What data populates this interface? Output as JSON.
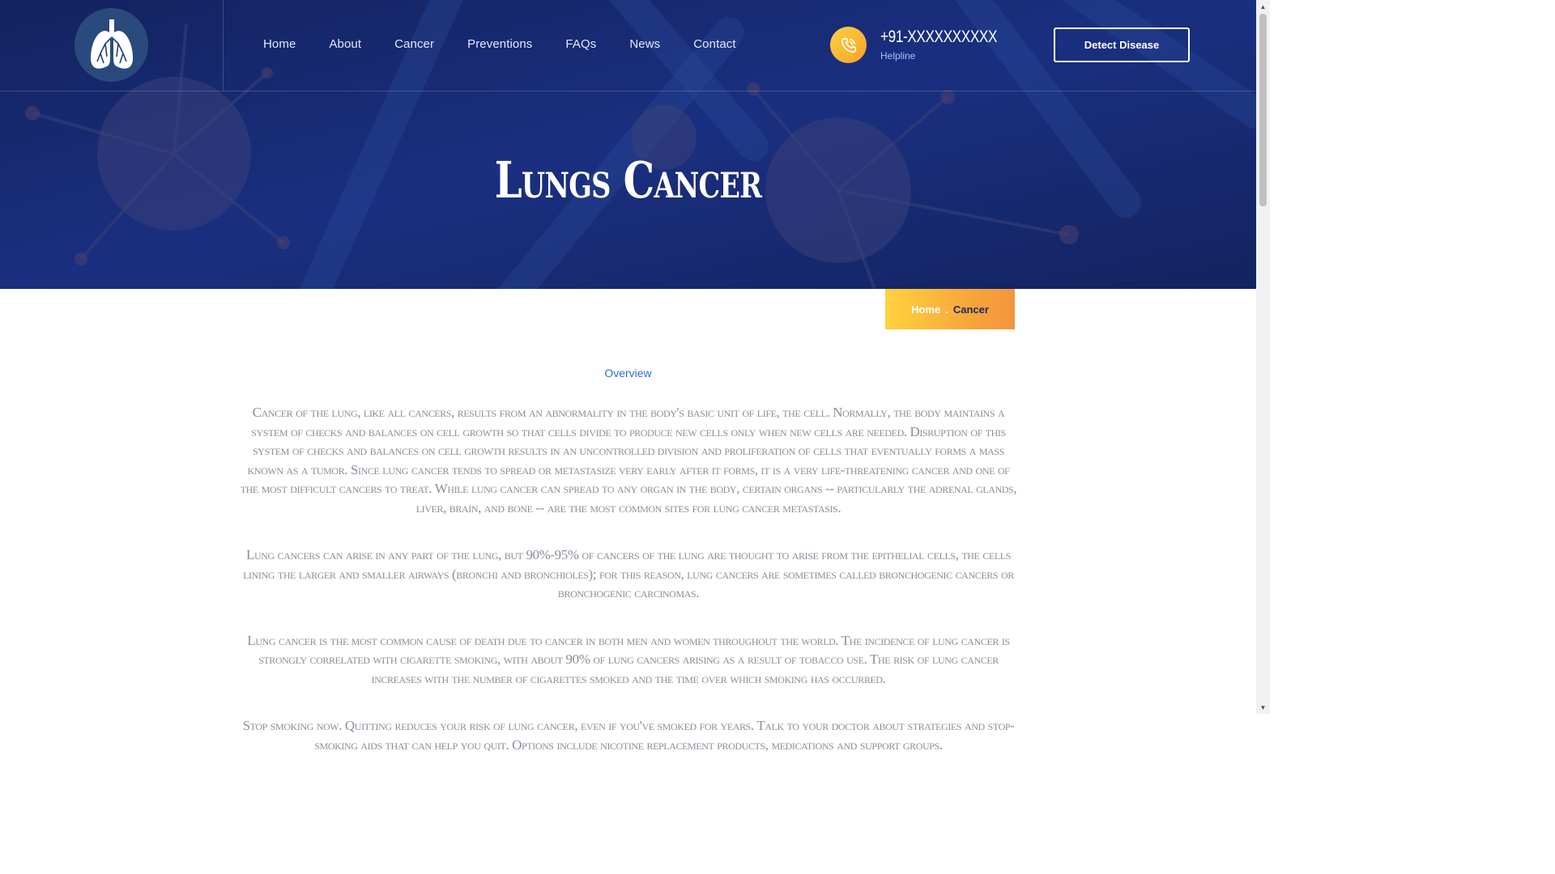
{
  "brand": {
    "logo_icon": "lungs-icon"
  },
  "nav": {
    "items": [
      {
        "label": "Home"
      },
      {
        "label": "About"
      },
      {
        "label": "Cancer"
      },
      {
        "label": "Preventions"
      },
      {
        "label": "FAQs"
      },
      {
        "label": "News"
      },
      {
        "label": "Contact"
      }
    ]
  },
  "contact": {
    "icon": "phone-icon",
    "number": "+91-XXXXXXXXXX",
    "label": "Helpline"
  },
  "cta": {
    "label": "Detect Disease"
  },
  "hero": {
    "title": "Lungs Cancer"
  },
  "breadcrumb": {
    "home": "Home",
    "separator": ".",
    "current": "Cancer"
  },
  "section": {
    "tag": "Overview"
  },
  "paragraphs": [
    "Cancer of the lung, like all cancers, results from an abnormality in the body's basic unit of life, the cell. Normally, the body maintains a system of checks and balances on cell growth so that cells divide to produce new cells only when new cells are needed. Disruption of this system of checks and balances on cell growth results in an uncontrolled division and proliferation of cells that eventually forms a mass known as a tumor. Since lung cancer tends to spread or metastasize very early after it forms, it is a very life-threatening cancer and one of the most difficult cancers to treat. While lung cancer can spread to any organ in the body, certain organs -- particularly the adrenal glands, liver, brain, and bone -- are the most common sites for lung cancer metastasis.",
    "Lung cancers can arise in any part of the lung, but 90%-95% of cancers of the lung are thought to arise from the epithelial cells, the cells lining the larger and smaller airways (bronchi and bronchioles); for this reason, lung cancers are sometimes called bronchogenic cancers or bronchogenic carcinomas.",
    "Lung cancer is the most common cause of death due to cancer in both men and women throughout the world. The incidence of lung cancer is strongly correlated with cigarette smoking, with about 90% of lung cancers arising as a result of tobacco use. The risk of lung cancer increases with the number of cigarettes smoked and the time over which smoking has occurred.",
    "Stop smoking now. Quitting reduces your risk of lung cancer, even if you've smoked for years. Talk to your doctor about strategies and stop-smoking aids that can help you quit. Options include nicotine replacement products, medications and support groups."
  ],
  "colors": {
    "hero_bg": "#14266a",
    "accent_yellow": "#ffd23f",
    "accent_orange": "#f7a12a",
    "link_blue": "#2f70c9",
    "body_text": "#8a8f9a"
  }
}
